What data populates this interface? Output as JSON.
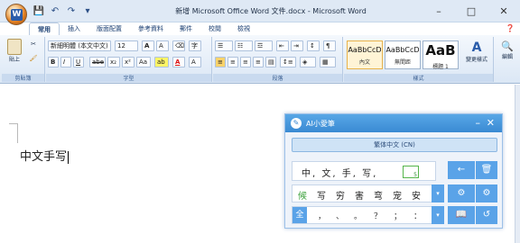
{
  "window": {
    "title": "新增 Microsoft Office Word 文件.docx - Microsoft Word",
    "minimize": "–",
    "maximize": "□",
    "close": "✕"
  },
  "qat": [
    "💾",
    "↶",
    "↷",
    "▾"
  ],
  "tabs": [
    "常用",
    "插入",
    "版面配置",
    "參考資料",
    "郵件",
    "校閱",
    "檢視"
  ],
  "ribbon": {
    "groups": {
      "clipboard": "剪貼簿",
      "font": "字型",
      "paragraph": "段落",
      "styles": "樣式"
    },
    "paste_label": "貼上",
    "font_name": "新細明體 (本文中文)",
    "font_size": "12",
    "bold": "B",
    "italic": "I",
    "underline": "U",
    "strike": "abe",
    "sub": "x₂",
    "sup": "x²",
    "change_case": "Aa",
    "highlight": "ab",
    "font_color": "A",
    "styles": [
      {
        "sample": "AaBbCcD",
        "name": "內文"
      },
      {
        "sample": "AaBbCcD",
        "name": "無間距"
      },
      {
        "sample": "AaB",
        "name": "標題 1"
      }
    ],
    "change_styles": "變更樣式",
    "edit": "編輯"
  },
  "document": {
    "text": "中文手写"
  },
  "ime": {
    "title": "AI小愛筆",
    "mode": "繁体中文 (CN)",
    "composition": "中, 文, 手, 写,",
    "comp_index": "5",
    "candidates": [
      "候",
      "写",
      "穷",
      "害",
      "弯",
      "宠",
      "安"
    ],
    "punctuation": [
      "全",
      "，",
      "、",
      "。",
      "？",
      "；",
      "："
    ],
    "side_buttons": [
      "←",
      "🗑",
      "⚙",
      "⚙",
      "📖",
      "↺"
    ]
  },
  "colors": {
    "accent": "#3a8ad3",
    "selected_candidate": "#3aa03a"
  }
}
